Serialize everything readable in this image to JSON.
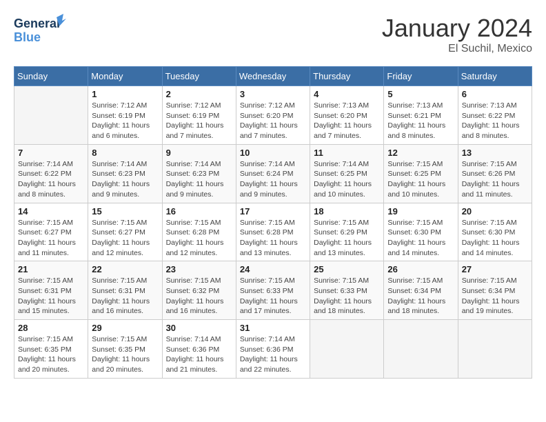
{
  "header": {
    "logo_general": "General",
    "logo_blue": "Blue",
    "month_title": "January 2024",
    "location": "El Suchil, Mexico"
  },
  "days_of_week": [
    "Sunday",
    "Monday",
    "Tuesday",
    "Wednesday",
    "Thursday",
    "Friday",
    "Saturday"
  ],
  "weeks": [
    [
      {
        "day": "",
        "empty": true
      },
      {
        "day": "1",
        "sunrise": "Sunrise: 7:12 AM",
        "sunset": "Sunset: 6:19 PM",
        "daylight": "Daylight: 11 hours and 6 minutes."
      },
      {
        "day": "2",
        "sunrise": "Sunrise: 7:12 AM",
        "sunset": "Sunset: 6:19 PM",
        "daylight": "Daylight: 11 hours and 7 minutes."
      },
      {
        "day": "3",
        "sunrise": "Sunrise: 7:12 AM",
        "sunset": "Sunset: 6:20 PM",
        "daylight": "Daylight: 11 hours and 7 minutes."
      },
      {
        "day": "4",
        "sunrise": "Sunrise: 7:13 AM",
        "sunset": "Sunset: 6:20 PM",
        "daylight": "Daylight: 11 hours and 7 minutes."
      },
      {
        "day": "5",
        "sunrise": "Sunrise: 7:13 AM",
        "sunset": "Sunset: 6:21 PM",
        "daylight": "Daylight: 11 hours and 8 minutes."
      },
      {
        "day": "6",
        "sunrise": "Sunrise: 7:13 AM",
        "sunset": "Sunset: 6:22 PM",
        "daylight": "Daylight: 11 hours and 8 minutes."
      }
    ],
    [
      {
        "day": "7",
        "sunrise": "Sunrise: 7:14 AM",
        "sunset": "Sunset: 6:22 PM",
        "daylight": "Daylight: 11 hours and 8 minutes."
      },
      {
        "day": "8",
        "sunrise": "Sunrise: 7:14 AM",
        "sunset": "Sunset: 6:23 PM",
        "daylight": "Daylight: 11 hours and 9 minutes."
      },
      {
        "day": "9",
        "sunrise": "Sunrise: 7:14 AM",
        "sunset": "Sunset: 6:23 PM",
        "daylight": "Daylight: 11 hours and 9 minutes."
      },
      {
        "day": "10",
        "sunrise": "Sunrise: 7:14 AM",
        "sunset": "Sunset: 6:24 PM",
        "daylight": "Daylight: 11 hours and 9 minutes."
      },
      {
        "day": "11",
        "sunrise": "Sunrise: 7:14 AM",
        "sunset": "Sunset: 6:25 PM",
        "daylight": "Daylight: 11 hours and 10 minutes."
      },
      {
        "day": "12",
        "sunrise": "Sunrise: 7:15 AM",
        "sunset": "Sunset: 6:25 PM",
        "daylight": "Daylight: 11 hours and 10 minutes."
      },
      {
        "day": "13",
        "sunrise": "Sunrise: 7:15 AM",
        "sunset": "Sunset: 6:26 PM",
        "daylight": "Daylight: 11 hours and 11 minutes."
      }
    ],
    [
      {
        "day": "14",
        "sunrise": "Sunrise: 7:15 AM",
        "sunset": "Sunset: 6:27 PM",
        "daylight": "Daylight: 11 hours and 11 minutes."
      },
      {
        "day": "15",
        "sunrise": "Sunrise: 7:15 AM",
        "sunset": "Sunset: 6:27 PM",
        "daylight": "Daylight: 11 hours and 12 minutes."
      },
      {
        "day": "16",
        "sunrise": "Sunrise: 7:15 AM",
        "sunset": "Sunset: 6:28 PM",
        "daylight": "Daylight: 11 hours and 12 minutes."
      },
      {
        "day": "17",
        "sunrise": "Sunrise: 7:15 AM",
        "sunset": "Sunset: 6:28 PM",
        "daylight": "Daylight: 11 hours and 13 minutes."
      },
      {
        "day": "18",
        "sunrise": "Sunrise: 7:15 AM",
        "sunset": "Sunset: 6:29 PM",
        "daylight": "Daylight: 11 hours and 13 minutes."
      },
      {
        "day": "19",
        "sunrise": "Sunrise: 7:15 AM",
        "sunset": "Sunset: 6:30 PM",
        "daylight": "Daylight: 11 hours and 14 minutes."
      },
      {
        "day": "20",
        "sunrise": "Sunrise: 7:15 AM",
        "sunset": "Sunset: 6:30 PM",
        "daylight": "Daylight: 11 hours and 14 minutes."
      }
    ],
    [
      {
        "day": "21",
        "sunrise": "Sunrise: 7:15 AM",
        "sunset": "Sunset: 6:31 PM",
        "daylight": "Daylight: 11 hours and 15 minutes."
      },
      {
        "day": "22",
        "sunrise": "Sunrise: 7:15 AM",
        "sunset": "Sunset: 6:31 PM",
        "daylight": "Daylight: 11 hours and 16 minutes."
      },
      {
        "day": "23",
        "sunrise": "Sunrise: 7:15 AM",
        "sunset": "Sunset: 6:32 PM",
        "daylight": "Daylight: 11 hours and 16 minutes."
      },
      {
        "day": "24",
        "sunrise": "Sunrise: 7:15 AM",
        "sunset": "Sunset: 6:33 PM",
        "daylight": "Daylight: 11 hours and 17 minutes."
      },
      {
        "day": "25",
        "sunrise": "Sunrise: 7:15 AM",
        "sunset": "Sunset: 6:33 PM",
        "daylight": "Daylight: 11 hours and 18 minutes."
      },
      {
        "day": "26",
        "sunrise": "Sunrise: 7:15 AM",
        "sunset": "Sunset: 6:34 PM",
        "daylight": "Daylight: 11 hours and 18 minutes."
      },
      {
        "day": "27",
        "sunrise": "Sunrise: 7:15 AM",
        "sunset": "Sunset: 6:34 PM",
        "daylight": "Daylight: 11 hours and 19 minutes."
      }
    ],
    [
      {
        "day": "28",
        "sunrise": "Sunrise: 7:15 AM",
        "sunset": "Sunset: 6:35 PM",
        "daylight": "Daylight: 11 hours and 20 minutes."
      },
      {
        "day": "29",
        "sunrise": "Sunrise: 7:15 AM",
        "sunset": "Sunset: 6:35 PM",
        "daylight": "Daylight: 11 hours and 20 minutes."
      },
      {
        "day": "30",
        "sunrise": "Sunrise: 7:14 AM",
        "sunset": "Sunset: 6:36 PM",
        "daylight": "Daylight: 11 hours and 21 minutes."
      },
      {
        "day": "31",
        "sunrise": "Sunrise: 7:14 AM",
        "sunset": "Sunset: 6:36 PM",
        "daylight": "Daylight: 11 hours and 22 minutes."
      },
      {
        "day": "",
        "empty": true
      },
      {
        "day": "",
        "empty": true
      },
      {
        "day": "",
        "empty": true
      }
    ]
  ]
}
